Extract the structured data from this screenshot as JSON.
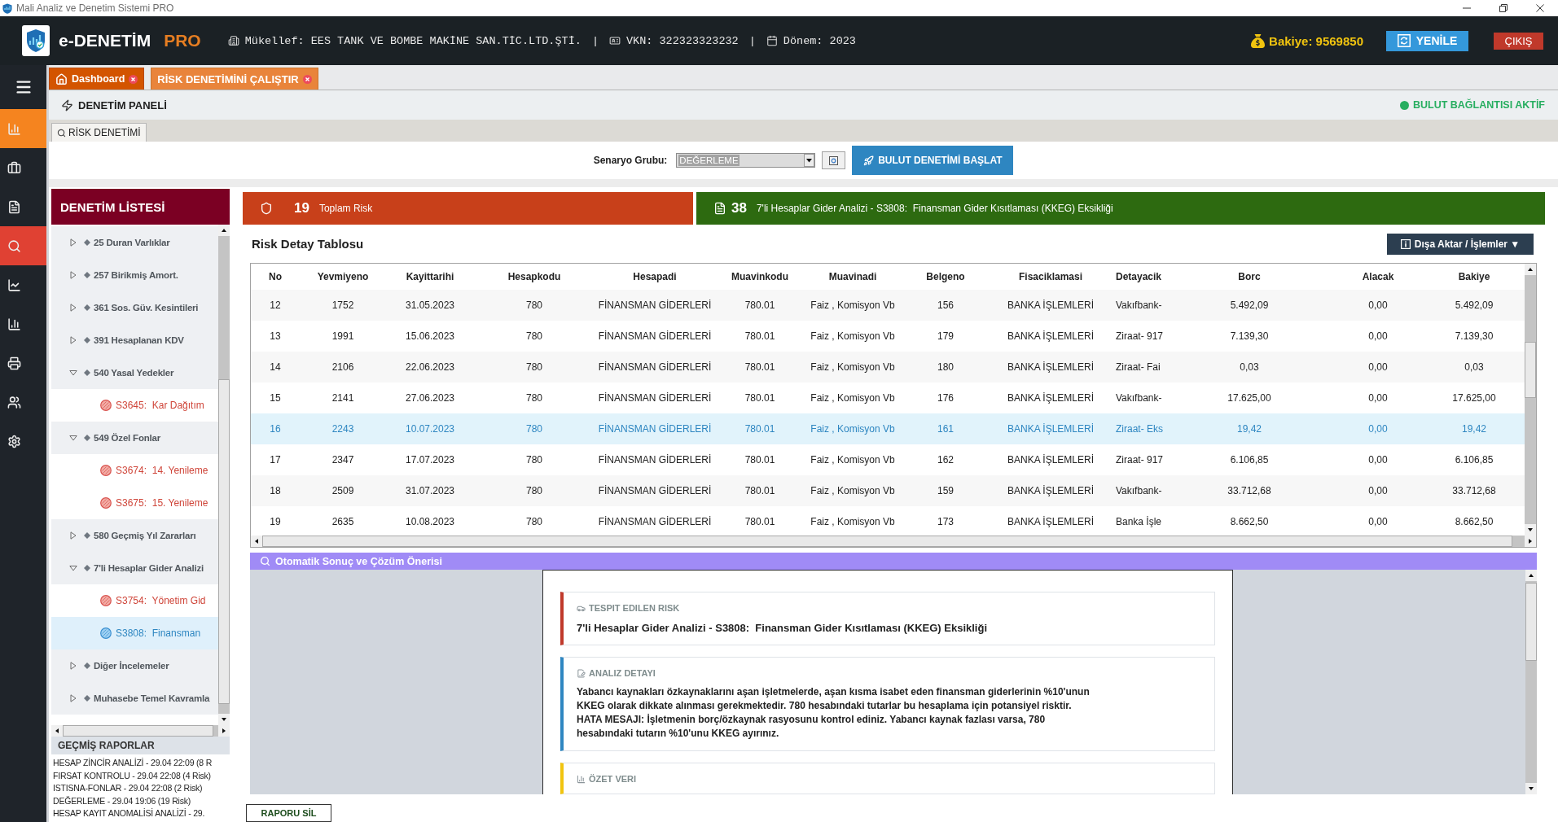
{
  "window": {
    "title": "Mali Analiz ve Denetim Sistemi PRO"
  },
  "header": {
    "brand": "e-DENETİM",
    "edition": "PRO",
    "info": [
      {
        "kind": "taxpayer",
        "text": "Mükellef: EES TANK VE BOMBE MAKİNE SAN.TİC.LTD.ŞTİ."
      },
      {
        "kind": "separator",
        "text": "|"
      },
      {
        "kind": "tax_id",
        "text": "VKN: 322323323232"
      },
      {
        "kind": "separator",
        "text": "|"
      },
      {
        "kind": "period",
        "text": "Dönem: 2023"
      }
    ],
    "balance": "Bakiye: 9569850",
    "refresh_button": "YENİLE",
    "exit_button": "ÇIKIŞ"
  },
  "nav": [
    {
      "highlighted": true,
      "selected": false
    },
    {
      "highlighted": false,
      "selected": false
    },
    {
      "highlighted": false,
      "selected": false
    },
    {
      "highlighted": false,
      "selected": true
    },
    {
      "highlighted": false,
      "selected": false
    },
    {
      "highlighted": false,
      "selected": false
    },
    {
      "highlighted": false,
      "selected": false
    },
    {
      "highlighted": false,
      "selected": false
    },
    {
      "highlighted": false,
      "selected": false
    }
  ],
  "tabs": [
    {
      "kind": "home",
      "label": "Dashboard",
      "selected": false
    },
    {
      "kind": "page",
      "label": "RİSK DENETİMİNİ ÇALIŞTIR",
      "selected": true
    }
  ],
  "panel": {
    "title": "DENETİM PANELİ",
    "connection": {
      "label": "BULUT BAĞLANTISI AKTİF",
      "on": true
    }
  },
  "subtabs": [
    {
      "label": "RİSK DENETİMİ",
      "selected": true
    }
  ],
  "toolbar": {
    "scenario_label": "Senaryo Grubu:",
    "scenario_value": "DEĞERLEME",
    "start_button": "BULUT DENETİMİ BAŞLAT"
  },
  "audit_list": {
    "title": "DENETİM LİSTESİ",
    "items": [
      {
        "label": "25 Duran Varlıklar",
        "expanded": false
      },
      {
        "label": "257 Birikmiş Amort.",
        "expanded": false
      },
      {
        "label": "361 Sos. Güv. Kesintileri",
        "expanded": false
      },
      {
        "label": "391 Hesaplanan KDV",
        "expanded": false
      },
      {
        "label": "540 Yasal Yedekler",
        "expanded": true,
        "children": [
          {
            "label": "S3645:  Kar Dağıtım",
            "selected": false
          }
        ]
      },
      {
        "label": "549 Özel Fonlar",
        "expanded": true,
        "children": [
          {
            "label": "S3674:  14. Yenileme",
            "selected": false
          },
          {
            "label": "S3675:  15. Yenileme",
            "selected": false
          }
        ]
      },
      {
        "label": "580 Geçmiş Yıl Zararları",
        "expanded": false
      },
      {
        "label": "7'li Hesaplar Gider Analizi",
        "expanded": true,
        "children": [
          {
            "label": "S3754:  Yönetim Gid",
            "selected": false
          },
          {
            "label": "S3808:  Finansman",
            "selected": true
          }
        ]
      },
      {
        "label": "Diğer İncelemeler",
        "expanded": false
      },
      {
        "label": "Muhasebe Temel Kavramla",
        "expanded": false
      }
    ]
  },
  "history": {
    "title": "GEÇMİŞ RAPORLAR",
    "items": [
      "HESAP ZİNCİR ANALİZİ - 29.04 22:09 (8 R",
      "FIRSAT KONTROLU - 29.04 22:08 (4 Risk)",
      "ISTISNA-FONLAR - 29.04 22:08 (2 Risk)",
      "DEĞERLEME - 29.04 19:06 (19 Risk)",
      "HESAP KAYIT ANOMALİSİ ANALİZİ - 29."
    ]
  },
  "summary": [
    {
      "kind": "risk",
      "count": "19",
      "label": "Toplam Risk"
    },
    {
      "kind": "scenario",
      "count": "38",
      "label": "7'li Hesaplar Gider Analizi - S3808:  Finansman Gider Kısıtlaması (KKEG) Eksikliği"
    }
  ],
  "table": {
    "title": "Risk Detay Tablosu",
    "export_button": "Dışa Aktar / İşlemler ▼",
    "columns": [
      "No",
      "Yevmiyeno",
      "Kayittarihi",
      "Hesapkodu",
      "Hesapadi",
      "Muavinkodu",
      "Muavinadi",
      "Belgeno",
      "Fisaciklamasi",
      "Detayacik",
      "Borc",
      "Alacak",
      "Bakiye"
    ],
    "rows": [
      {
        "selected": false,
        "cells": [
          "12",
          "1752",
          "31.05.2023",
          "780",
          "FİNANSMAN GİDERLERİ",
          "780.01",
          "Faiz , Komisyon Vb",
          "156",
          "BANKA İŞLEMLERİ",
          "Vakıfbank-",
          "5.492,09",
          "0,00",
          "5.492,09"
        ]
      },
      {
        "selected": false,
        "cells": [
          "13",
          "1991",
          "15.06.2023",
          "780",
          "FİNANSMAN GİDERLERİ",
          "780.01",
          "Faiz , Komisyon Vb",
          "179",
          "BANKA İŞLEMLERİ",
          "Ziraat- 917",
          "7.139,30",
          "0,00",
          "7.139,30"
        ]
      },
      {
        "selected": false,
        "cells": [
          "14",
          "2106",
          "22.06.2023",
          "780",
          "FİNANSMAN GİDERLERİ",
          "780.01",
          "Faiz , Komisyon Vb",
          "180",
          "BANKA İŞLEMLERİ",
          "Ziraat- Fai",
          "0,03",
          "0,00",
          "0,03"
        ]
      },
      {
        "selected": false,
        "cells": [
          "15",
          "2141",
          "27.06.2023",
          "780",
          "FİNANSMAN GİDERLERİ",
          "780.01",
          "Faiz , Komisyon Vb",
          "176",
          "BANKA İŞLEMLERİ",
          "Vakıfbank-",
          "17.625,00",
          "0,00",
          "17.625,00"
        ]
      },
      {
        "selected": true,
        "cells": [
          "16",
          "2243",
          "10.07.2023",
          "780",
          "FİNANSMAN GİDERLERİ",
          "780.01",
          "Faiz , Komisyon Vb",
          "161",
          "BANKA İŞLEMLERİ",
          "Ziraat- Eks",
          "19,42",
          "0,00",
          "19,42"
        ]
      },
      {
        "selected": false,
        "cells": [
          "17",
          "2347",
          "17.07.2023",
          "780",
          "FİNANSMAN GİDERLERİ",
          "780.01",
          "Faiz , Komisyon Vb",
          "162",
          "BANKA İŞLEMLERİ",
          "Ziraat- 917",
          "6.106,85",
          "0,00",
          "6.106,85"
        ]
      },
      {
        "selected": false,
        "cells": [
          "18",
          "2509",
          "31.07.2023",
          "780",
          "FİNANSMAN GİDERLERİ",
          "780.01",
          "Faiz , Komisyon Vb",
          "159",
          "BANKA İŞLEMLERİ",
          "Vakıfbank-",
          "33.712,68",
          "0,00",
          "33.712,68"
        ]
      },
      {
        "selected": false,
        "cells": [
          "19",
          "2635",
          "10.08.2023",
          "780",
          "FİNANSMAN GİDERLERİ",
          "780.01",
          "Faiz , Komisyon Vb",
          "173",
          "BANKA İŞLEMLERİ",
          "Banka İşle",
          "8.662,50",
          "0,00",
          "8.662,50"
        ]
      }
    ]
  },
  "results": {
    "title": "Otomatik Sonuç ve Çözüm Önerisi",
    "sections": [
      {
        "kind": "risk",
        "heading": "TESPIT EDILEN RISK",
        "text": "7'li Hesaplar Gider Analizi - S3808:  Finansman Gider Kısıtlaması (KKEG) Eksikliği"
      },
      {
        "kind": "analysis",
        "heading": "ANALIZ DETAYI",
        "text": "Yabancı kaynakları özkaynaklarını aşan işletmelerde, aşan kısma isabet eden finansman giderlerinin %10'unun KKEG olarak dikkate alınması gerekmektedir. 780 hesabındaki tutarlar bu hesaplama için potansiyel risktir. HATA MESAJI: İşletmenin borç/özkaynak rasyosunu kontrol ediniz. Yabancı kaynak fazlası varsa, 780 hesabındaki tutarın %10'unu KKEG ayırınız."
      },
      {
        "kind": "summary",
        "heading": "ÖZET VERI"
      }
    ]
  },
  "delete_button": "RAPORU SİL"
}
